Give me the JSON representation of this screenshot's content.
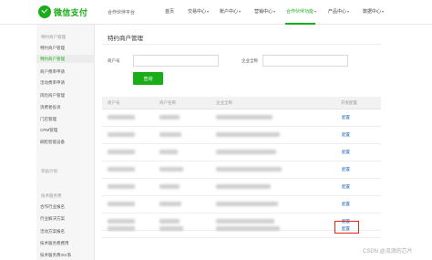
{
  "header": {
    "logo_text": "微信支付",
    "platform_label": "合作伙伴平台",
    "nav": [
      "首页",
      "交易中心",
      "账户中心",
      "营销中心",
      "合作伙伴功能",
      "产品中心",
      "数据中心"
    ],
    "active_nav": "合作伙伴功能",
    "brand_color": "#1aad19"
  },
  "sidebar": {
    "group1_title": "特约商户管理",
    "group1_items": [
      "特约商户管理",
      "特约商户管理",
      "商户费率申请",
      "活动费率申请",
      "风险商户管理",
      "消费者投诉",
      "门店管理",
      "CRM管理",
      "刷脸智能设备"
    ],
    "group2_title": "奖励计划",
    "group3_title": "技术服务费",
    "group3_items": [
      "合作行业报名",
      "行业解决方案",
      "活动方案报名",
      "技术服务费费用",
      "技术服务费ISV系"
    ]
  },
  "main": {
    "title": "特约商户管理",
    "merchant_id_label": "商户号",
    "company_name_label": "企业全称",
    "query_button": "查询",
    "columns": [
      "商户号",
      "商户名称",
      "企业全称",
      "",
      "开发配置"
    ],
    "config_link": "配置",
    "row_count": 8
  },
  "watermark": "CSDN @流浪的芯片"
}
